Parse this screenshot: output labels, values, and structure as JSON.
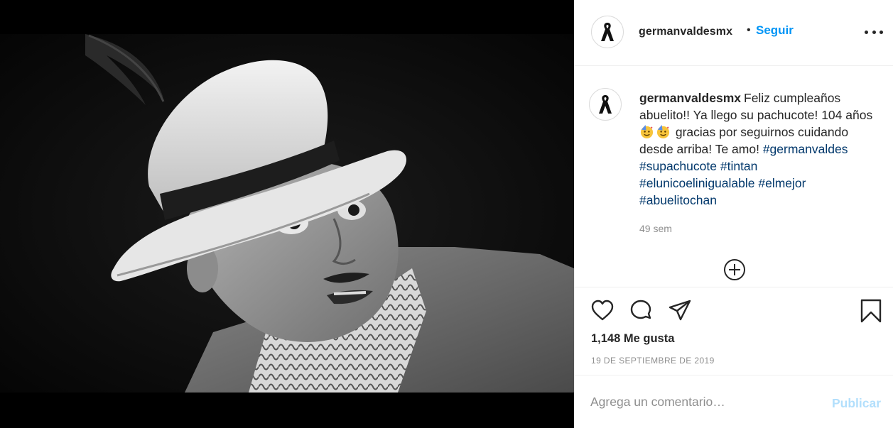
{
  "post": {
    "media_description": "Black-and-white portrait photograph of a man in a white fedora with a feather and a patterned shirt",
    "author": {
      "username": "germanvaldesmx",
      "avatar_icon": "black-ribbon-icon"
    },
    "header": {
      "separator": "•",
      "follow_label": "Seguir",
      "more_icon": "more-options-icon"
    },
    "caption": {
      "username": "germanvaldesmx",
      "text_1": "Feliz cumpleaños abuelito!! Ya llego su pachucote! 104 años",
      "emoji": "partying-face",
      "text_2": "gracias por seguirnos cuidando desde arriba! Te amo!",
      "hashtags": [
        "#germanvaldes",
        "#supachucote",
        "#tintan",
        "#elunicoelinigualable",
        "#elmejor",
        "#abuelitochan"
      ]
    },
    "time_ago": "49 sem",
    "load_more_icon": "plus-circle-icon",
    "likes": "1,148 Me gusta",
    "date": "19 DE SEPTIEMBRE DE 2019",
    "comment": {
      "placeholder": "Agrega un comentario…",
      "value": "",
      "publish_label": "Publicar"
    },
    "colors": {
      "link_blue": "#0095f6",
      "hashtag": "#00376b",
      "secondary_text": "#8e8e8e",
      "publish_disabled": "#b2dffc",
      "border": "#efefef"
    }
  }
}
